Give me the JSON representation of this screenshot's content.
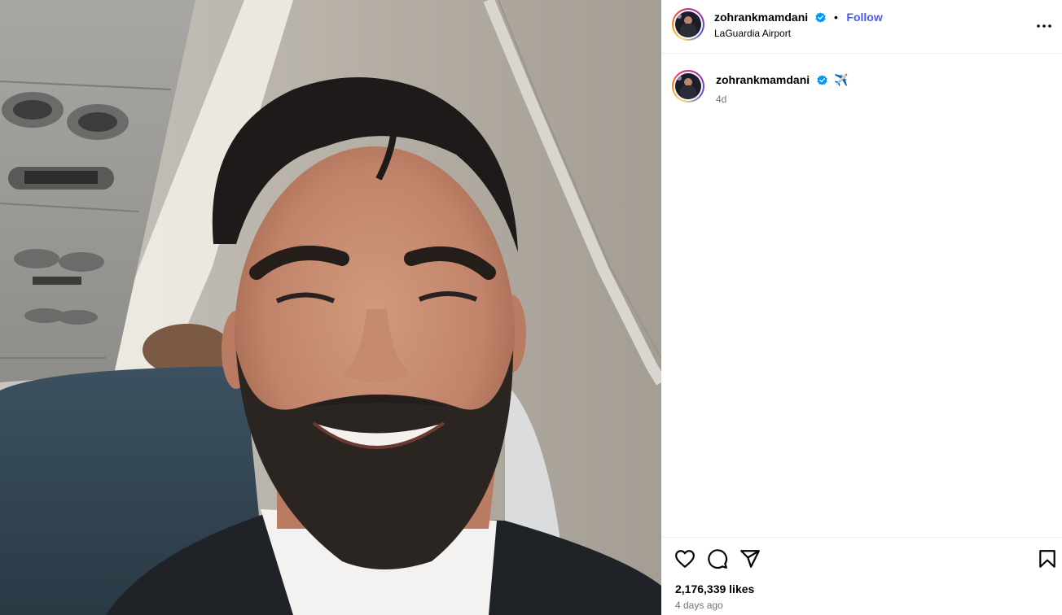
{
  "post": {
    "username": "zohrankmamdani",
    "follow_label": "Follow",
    "separator": "•",
    "location": "LaGuardia Airport",
    "caption_emoji": "✈️",
    "caption_time": "4d",
    "likes": "2,176,339 likes",
    "posted_ago": "4 days ago"
  },
  "icons": {
    "more": "more-options-icon",
    "like": "heart-icon",
    "comment": "comment-icon",
    "share": "share-icon",
    "save": "bookmark-icon",
    "verified": "verified-badge-icon"
  },
  "colors": {
    "follow": "#4a5df9",
    "verified": "#0095f6",
    "muted_text": "#737373",
    "divider": "#efefef"
  }
}
